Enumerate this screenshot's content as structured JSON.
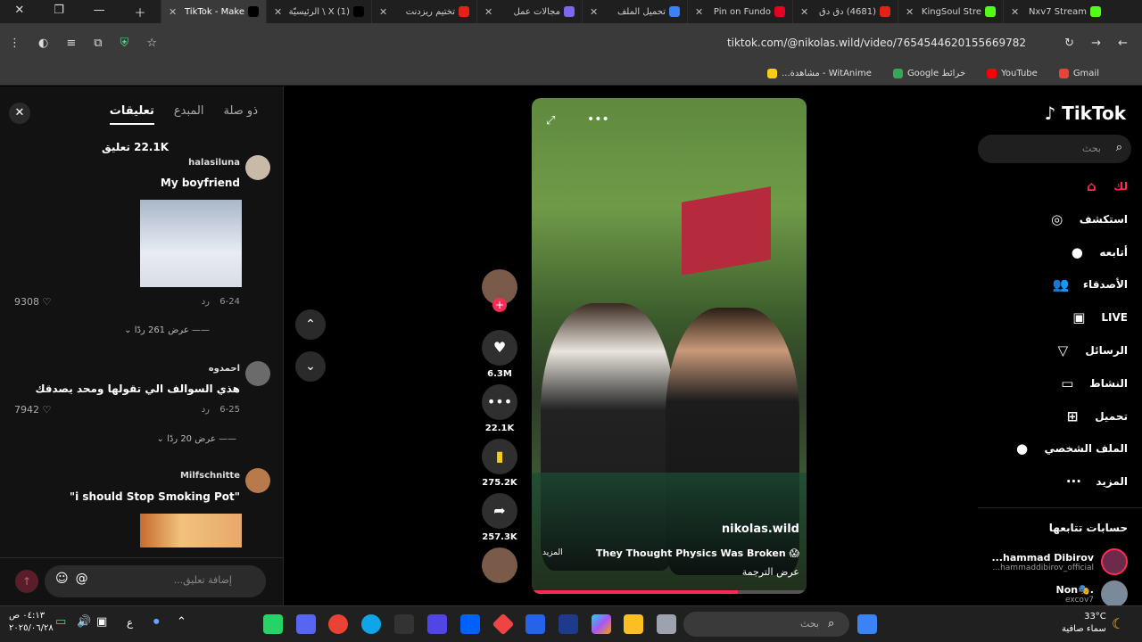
{
  "tabs": [
    {
      "title": "TikTok - Make",
      "active": true,
      "color": "#000000"
    },
    {
      "title": "(1) X \\ الرئيسيّة",
      "active": false,
      "color": "#000000"
    },
    {
      "title": "تختيم ريزدنت",
      "active": false,
      "color": "#e62117"
    },
    {
      "title": "مجالات عمل",
      "active": false,
      "color": "#7b68ee"
    },
    {
      "title": "تحميل الملف",
      "active": false,
      "color": "#3b82f6"
    },
    {
      "title": "Pin on Fundo",
      "active": false,
      "color": "#e60023"
    },
    {
      "title": "(4681) دق دق",
      "active": false,
      "color": "#e62117"
    },
    {
      "title": "KingSoul Stre",
      "active": false,
      "color": "#53fc18"
    },
    {
      "title": "Nxv7 Stream",
      "active": false,
      "color": "#53fc18"
    }
  ],
  "address": {
    "url": "tiktok.com/@nikolas.wild/video/7654544620155669782"
  },
  "bookmarks": [
    {
      "label": "Gmail",
      "color": "#ea4335"
    },
    {
      "label": "YouTube",
      "color": "#ff0000"
    },
    {
      "label": "خرائط Google",
      "color": "#34a853"
    },
    {
      "label": "WitAnime - مشاهدة...",
      "color": "#facc15"
    }
  ],
  "comments": {
    "tabs": [
      "تعليقات",
      "المبدع",
      "ذو صلة"
    ],
    "count": "22.1K تعليق",
    "items": [
      {
        "user": "halasiluna",
        "text": "My boyfriend",
        "date": "6-24",
        "reply": "رد",
        "likes": "9308",
        "replies": "عرض 261 ردًا"
      },
      {
        "user": "احمدوه",
        "text": "هذي السوالف الي تقولها ومحد يصدقك",
        "date": "6-25",
        "reply": "رد",
        "likes": "7942",
        "replies": "عرض 20 ردًا"
      },
      {
        "user": "Milfschnitte",
        "text": "\"i should Stop Smoking Pot\""
      }
    ],
    "input_placeholder": "إضافة تعليق..."
  },
  "video": {
    "author": "nikolas.wild",
    "caption": "They Thought Physics Was Broken 😱",
    "more": "المزيد",
    "translate": "عرض الترجمة",
    "progress": 0.75
  },
  "actions": [
    {
      "icon": "heart-icon",
      "glyph": "♥",
      "count": "6.3M"
    },
    {
      "icon": "comment-icon",
      "glyph": "•••",
      "count": "22.1K"
    },
    {
      "icon": "bookmark-icon",
      "glyph": "▮",
      "count": "275.2K"
    },
    {
      "icon": "share-icon",
      "glyph": "➦",
      "count": "257.3K"
    }
  ],
  "nav": {
    "logo": "TikTok",
    "search_placeholder": "بحث",
    "items": [
      {
        "label": "لك",
        "icon": "home-icon",
        "glyph": "⌂"
      },
      {
        "label": "استكشف",
        "icon": "compass-icon",
        "glyph": "◎"
      },
      {
        "label": "أتابعه",
        "icon": "following-icon",
        "glyph": "●"
      },
      {
        "label": "الأصدقاء",
        "icon": "friends-icon",
        "glyph": "👥"
      },
      {
        "label": "LIVE",
        "icon": "live-icon",
        "glyph": "▣"
      },
      {
        "label": "الرسائل",
        "icon": "messages-icon",
        "glyph": "▽"
      },
      {
        "label": "النشاط",
        "icon": "activity-icon",
        "glyph": "▭"
      },
      {
        "label": "تحميل",
        "icon": "upload-icon",
        "glyph": "⊞"
      },
      {
        "label": "الملف الشخصي",
        "icon": "profile-icon",
        "glyph": "●"
      },
      {
        "label": "المزيد",
        "icon": "more-icon",
        "glyph": "···"
      }
    ],
    "following_title": "حسابات تتابعها",
    "following": [
      {
        "name": "...hammad Dibirov",
        "handle": "...hammaddibirov_official"
      },
      {
        "name": "Non🎭.",
        "handle": "excov7"
      }
    ]
  },
  "taskbar": {
    "search": "بحث",
    "temp": "33°C",
    "weather": "سماء صافية",
    "time": "٠٤:١٣ ص",
    "date": "٢٠٢٥/٠٦/٢٨",
    "lang": "ع"
  }
}
